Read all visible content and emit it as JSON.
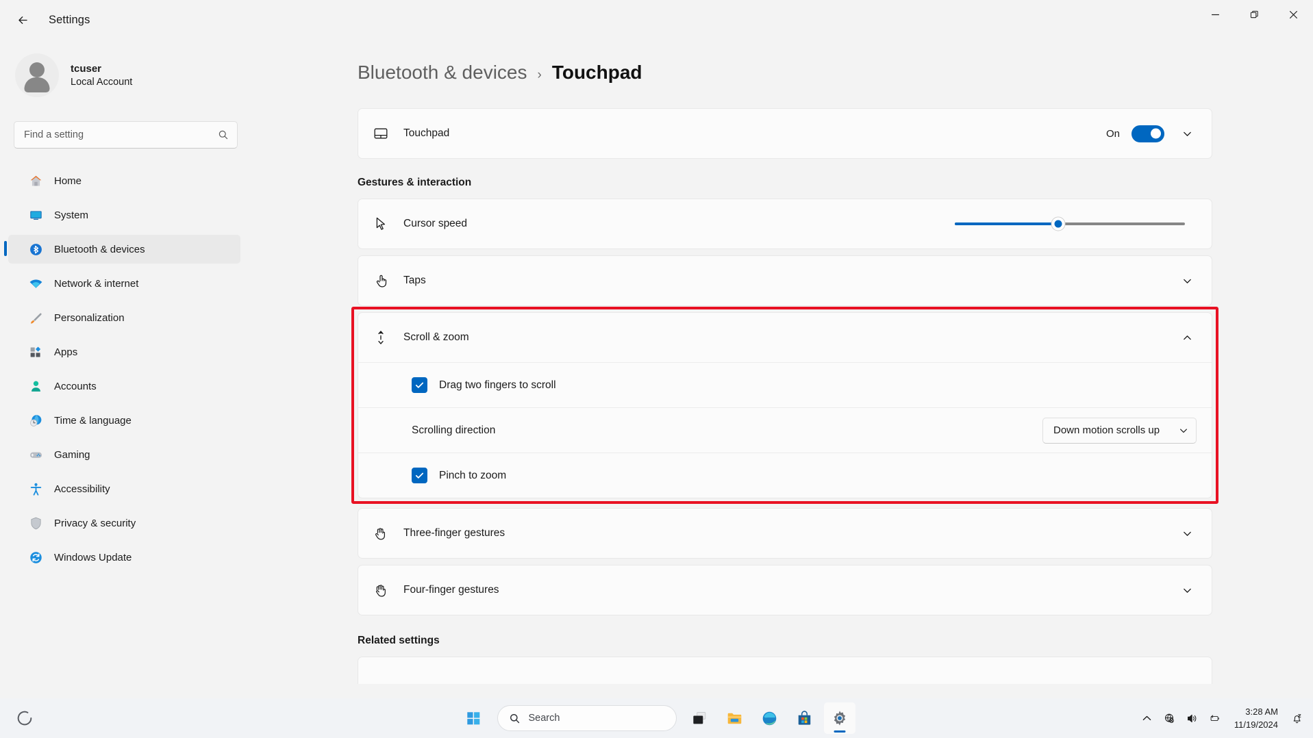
{
  "window": {
    "title": "Settings",
    "back_icon": "back-arrow-icon",
    "minimize_label": "Minimize",
    "maximize_label": "Restore",
    "close_label": "Close"
  },
  "account": {
    "name": "tcuser",
    "type": "Local Account"
  },
  "search": {
    "placeholder": "Find a setting",
    "value": "",
    "icon": "search-icon"
  },
  "sidebar": {
    "items": [
      {
        "label": "Home",
        "icon": "home-icon",
        "active": false
      },
      {
        "label": "System",
        "icon": "system-icon",
        "active": false
      },
      {
        "label": "Bluetooth & devices",
        "icon": "bluetooth-icon",
        "active": true
      },
      {
        "label": "Network & internet",
        "icon": "network-icon",
        "active": false
      },
      {
        "label": "Personalization",
        "icon": "personalization-icon",
        "active": false
      },
      {
        "label": "Apps",
        "icon": "apps-icon",
        "active": false
      },
      {
        "label": "Accounts",
        "icon": "accounts-icon",
        "active": false
      },
      {
        "label": "Time & language",
        "icon": "time-language-icon",
        "active": false
      },
      {
        "label": "Gaming",
        "icon": "gaming-icon",
        "active": false
      },
      {
        "label": "Accessibility",
        "icon": "accessibility-icon",
        "active": false
      },
      {
        "label": "Privacy & security",
        "icon": "privacy-security-icon",
        "active": false
      },
      {
        "label": "Windows Update",
        "icon": "windows-update-icon",
        "active": false
      }
    ]
  },
  "breadcrumb": {
    "parent": "Bluetooth & devices",
    "separator": "›",
    "current": "Touchpad"
  },
  "touchpad_card": {
    "label": "Touchpad",
    "icon": "touchpad-icon",
    "toggle_state": "On",
    "toggle_on": true,
    "expand_icon": "chevron-down-icon"
  },
  "gestures_section": {
    "title": "Gestures & interaction",
    "rows": [
      {
        "label": "Cursor speed",
        "icon": "cursor-arrow-icon",
        "control": "slider",
        "slider_percent": 45
      },
      {
        "label": "Taps",
        "icon": "tap-hand-icon",
        "control": "chevron",
        "expand_icon": "chevron-down-icon"
      }
    ]
  },
  "scroll_zoom": {
    "label": "Scroll & zoom",
    "icon": "scroll-updown-icon",
    "expanded": true,
    "expand_icon": "chevron-up-icon",
    "highlighted": true,
    "highlight_color": "#e81123",
    "settings": [
      {
        "type": "checkbox",
        "label": "Drag two fingers to scroll",
        "checked": true
      },
      {
        "type": "dropdown",
        "label": "Scrolling direction",
        "value": "Down motion scrolls up",
        "chevron_icon": "chevron-down-icon"
      },
      {
        "type": "checkbox",
        "label": "Pinch to zoom",
        "checked": true
      }
    ]
  },
  "more_gestures": [
    {
      "label": "Three-finger gestures",
      "icon": "three-finger-hand-icon",
      "expand_icon": "chevron-down-icon"
    },
    {
      "label": "Four-finger gestures",
      "icon": "four-finger-hand-icon",
      "expand_icon": "chevron-down-icon"
    }
  ],
  "related": {
    "title": "Related settings"
  },
  "taskbar": {
    "start_label": "Start",
    "search_placeholder": "Search",
    "search_icon": "search-icon",
    "items": [
      {
        "name": "task-view-icon",
        "label": "Task view",
        "active": false
      },
      {
        "name": "file-explorer-icon",
        "label": "File Explorer",
        "active": false
      },
      {
        "name": "edge-icon",
        "label": "Microsoft Edge",
        "active": false
      },
      {
        "name": "store-icon",
        "label": "Microsoft Store",
        "active": false
      },
      {
        "name": "settings-icon",
        "label": "Settings",
        "active": true
      }
    ],
    "tray": {
      "overflow_icon": "chevron-up-icon",
      "network_icon": "globe-no-internet-icon",
      "volume_icon": "speaker-icon",
      "battery_icon": "battery-icon",
      "time": "3:28 AM",
      "date": "11/19/2024",
      "notification_icon": "bell-quiet-icon"
    }
  },
  "colors": {
    "accent": "#0067c0",
    "highlight": "#e81123",
    "window_bg": "#f3f3f3",
    "card_bg": "#fbfbfb"
  }
}
